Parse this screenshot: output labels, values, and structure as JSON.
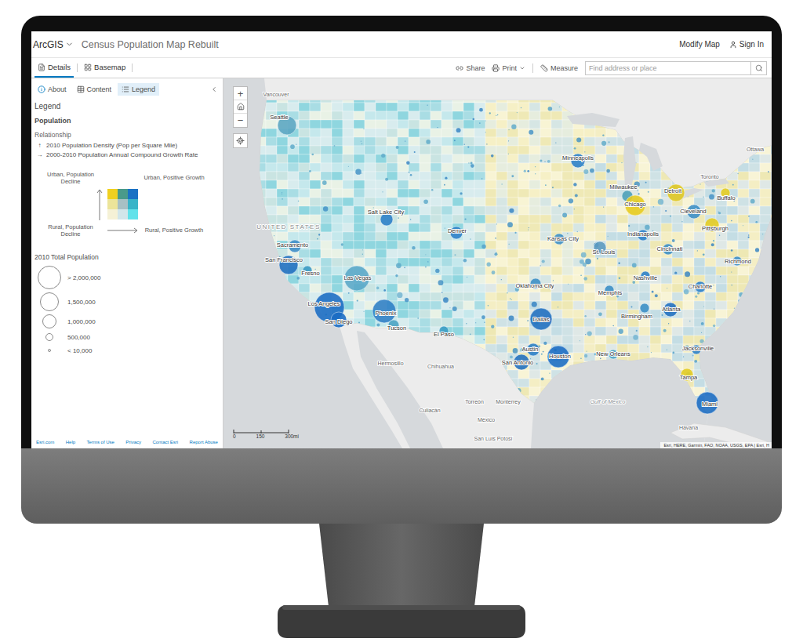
{
  "app_bar": {
    "product": "ArcGIS",
    "title": "Census Population Map Rebuilt",
    "actions": [
      "Modify Map",
      "Sign In"
    ]
  },
  "toolbar": {
    "tabs": [
      {
        "label": "Details",
        "selected": true
      },
      {
        "label": "Basemap",
        "selected": false
      }
    ],
    "actions": [
      "Share",
      "Print",
      "Measure"
    ],
    "search": {
      "placeholder": "Find address or place"
    }
  },
  "sidebar": {
    "tabs": [
      {
        "label": "About",
        "selected": false
      },
      {
        "label": "Content",
        "selected": false
      },
      {
        "label": "Legend",
        "selected": true
      }
    ],
    "heading": "Legend",
    "layer": "Population",
    "relationship": {
      "title": "Relationship",
      "axes": [
        {
          "arrow": "↑",
          "label": "2010 Population Density (Pop per Square Mile)"
        },
        {
          "arrow": "→",
          "label": "2000-2010 Population Annual Compound Growth Rate"
        }
      ],
      "corners": {
        "top_left": "Urban, Population Decline",
        "top_right": "Urban, Positive Growth",
        "bottom_left": "Rural, Population Decline",
        "bottom_right": "Rural, Positive Growth"
      },
      "grid": [
        [
          {
            "color": "#f0d020"
          },
          {
            "color": "#4a9a8a"
          },
          {
            "color": "#1a72c4"
          }
        ],
        [
          {
            "color": "#ece49a"
          },
          {
            "color": "#a7c0c4"
          },
          {
            "color": "#38b4c8"
          }
        ],
        [
          {
            "color": "#f5f1d6"
          },
          {
            "color": "#d2e6ea"
          },
          {
            "color": "#62e2ea"
          }
        ]
      ]
    },
    "size": {
      "title": "2010 Total Population",
      "items": [
        {
          "label": "> 2,000,000"
        },
        {
          "label": "1,500,000"
        },
        {
          "label": "1,000,000"
        },
        {
          "label": "500,000"
        },
        {
          "label": "< 10,000"
        }
      ]
    },
    "footer": [
      "Esri.com",
      "Help",
      "Terms of Use",
      "Privacy",
      "Contact Esri",
      "Report Abuse"
    ]
  },
  "map": {
    "controls": {
      "zoom_in": "+",
      "zoom_out": "−"
    },
    "country": "UNITED STATES",
    "water": "Gulf of Mexico",
    "places": [
      {
        "name": "Vancouver"
      },
      {
        "name": "Toronto"
      },
      {
        "name": "Ottawa"
      },
      {
        "name": "Hermosillo"
      },
      {
        "name": "Chihuahua"
      },
      {
        "name": "Culiacán"
      },
      {
        "name": "Torreón"
      },
      {
        "name": "Monterrey"
      },
      {
        "name": "San Luis Potosí"
      },
      {
        "name": "México"
      },
      {
        "name": "Havana"
      }
    ],
    "cities": [
      {
        "name": "Seattle",
        "color": "#5aa6c2"
      },
      {
        "name": "Sacramento",
        "color": "#3a8cc8"
      },
      {
        "name": "San Francisco",
        "color": "#1f6fc0"
      },
      {
        "name": "Fresno",
        "color": "#3a9ac4"
      },
      {
        "name": "Las Vegas",
        "color": "#5aa8c8"
      },
      {
        "name": "Los Angeles",
        "color": "#1a6cc4"
      },
      {
        "name": "San Diego",
        "color": "#1a6cc4"
      },
      {
        "name": "Phoenix",
        "color": "#2e7fc6"
      },
      {
        "name": "Tucson",
        "color": "#4aa3c4"
      },
      {
        "name": "El Paso",
        "color": "#3a9cc4"
      },
      {
        "name": "Salt Lake City",
        "color": "#2a7fc8"
      },
      {
        "name": "Denver",
        "color": "#2a7fc8"
      },
      {
        "name": "Oklahoma City",
        "color": "#3a8ec6"
      },
      {
        "name": "Dallas",
        "color": "#1f6fc0"
      },
      {
        "name": "Austin",
        "color": "#2a7fc8"
      },
      {
        "name": "San Antonio",
        "color": "#1f6fc0"
      },
      {
        "name": "Houston",
        "color": "#1a6cc4"
      },
      {
        "name": "New Orleans",
        "color": "#4aa3c4"
      },
      {
        "name": "Memphis",
        "color": "#3a8ec6"
      },
      {
        "name": "Nashville",
        "color": "#2a7fc8"
      },
      {
        "name": "Atlanta",
        "color": "#1f6fc0"
      },
      {
        "name": "Birmingham",
        "color": "#3a8ec6"
      },
      {
        "name": "Jacksonville",
        "color": "#2a7fc8"
      },
      {
        "name": "Tampa",
        "color": "#e4cc1e"
      },
      {
        "name": "Miami",
        "color": "#1a6cc4"
      },
      {
        "name": "Kansas City",
        "color": "#3a8ec6"
      },
      {
        "name": "St. Louis",
        "color": "#5a9ac0"
      },
      {
        "name": "Minneapolis",
        "color": "#2a7fc8"
      },
      {
        "name": "Milwaukee",
        "color": "#4aa0b8"
      },
      {
        "name": "Chicago",
        "color": "#e8cc20"
      },
      {
        "name": "Detroit",
        "color": "#e0c820"
      },
      {
        "name": "Cleveland",
        "color": "#3a8ec6"
      },
      {
        "name": "Pittsburgh",
        "color": "#e4cc1e"
      },
      {
        "name": "Buffalo",
        "color": "#e4cc1e"
      },
      {
        "name": "Indianapolis",
        "color": "#2a7fc8"
      },
      {
        "name": "Cincinnati",
        "color": "#3a8ec6"
      },
      {
        "name": "Richmond",
        "color": "#3a8ec6"
      },
      {
        "name": "Charlotte",
        "color": "#2a7fc8"
      }
    ],
    "scale": [
      "0",
      "150",
      "300mi"
    ],
    "attribution": "Esri, HERE, Garmin, FAO, NOAA, USGS, EPA | Esri, H"
  }
}
